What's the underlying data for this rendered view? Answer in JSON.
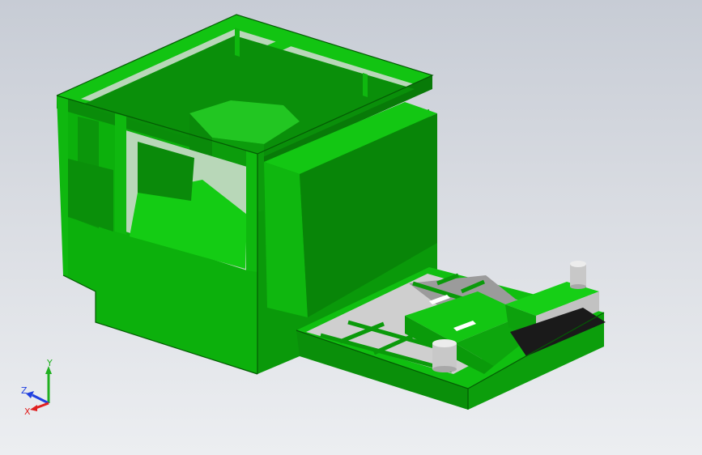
{
  "viewport": {
    "background_top": "#c7ccd5",
    "background_bottom": "#eceef1"
  },
  "model": {
    "primary_color": "#0fbf0f",
    "shade_color": "#0a8c0a",
    "dark_color": "#066b06",
    "light_color": "#1fd61f",
    "metal_color": "#bfbfbf",
    "metal_dark": "#8c8c8c"
  },
  "triad": {
    "x_label": "X",
    "y_label": "Y",
    "z_label": "Z",
    "x_color": "#e02020",
    "y_color": "#20b020",
    "z_color": "#2040e0"
  }
}
